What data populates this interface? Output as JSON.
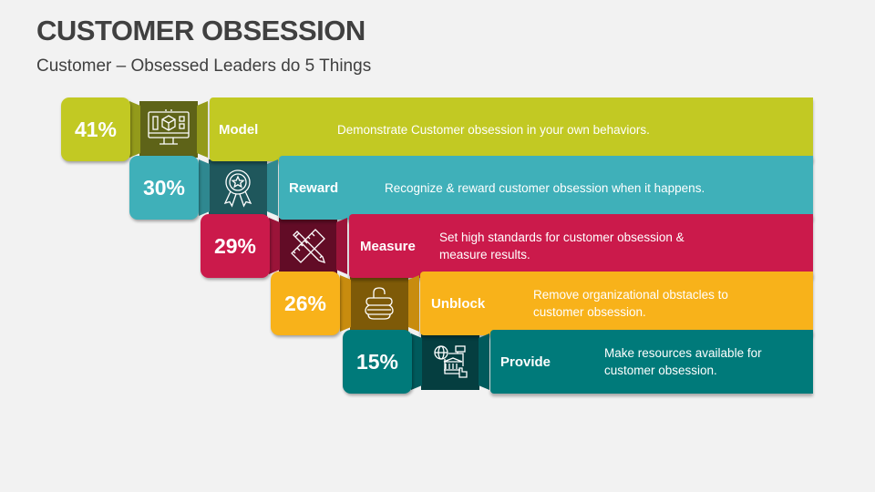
{
  "header": {
    "title": "CUSTOMER OBSESSION",
    "subtitle": "Customer – Obsessed Leaders do 5 Things"
  },
  "rows": [
    {
      "percent": "41%",
      "label": "Model",
      "description": "Demonstrate Customer obsession in your own behaviors.",
      "icon": "monitor-3d-cube-icon",
      "colors": {
        "main": "#c2c923",
        "fold": "#939a1b",
        "icon_bg": "#5e6318"
      }
    },
    {
      "percent": "30%",
      "label": "Reward",
      "description": "Recognize & reward customer obsession when it happens.",
      "icon": "award-ribbon-icon",
      "colors": {
        "main": "#3fb0b9",
        "fold": "#2f8890",
        "icon_bg": "#1f575c"
      }
    },
    {
      "percent": "29%",
      "label": "Measure",
      "description": "Set high standards for customer obsession & measure results.",
      "icon": "pencil-ruler-icon",
      "colors": {
        "main": "#cb1a4b",
        "fold": "#9b1439",
        "icon_bg": "#620c26"
      }
    },
    {
      "percent": "26%",
      "label": "Unblock",
      "description": "Remove organizational obstacles to customer obsession.",
      "icon": "unlocked-padlock-icon",
      "colors": {
        "main": "#f8b21a",
        "fold": "#c88c0f",
        "icon_bg": "#7e5a08"
      }
    },
    {
      "percent": "15%",
      "label": "Provide",
      "description": "Make resources available for customer obsession.",
      "icon": "global-resources-icon",
      "colors": {
        "main": "#007a7a",
        "fold": "#005a5c",
        "icon_bg": "#053e40"
      }
    }
  ]
}
